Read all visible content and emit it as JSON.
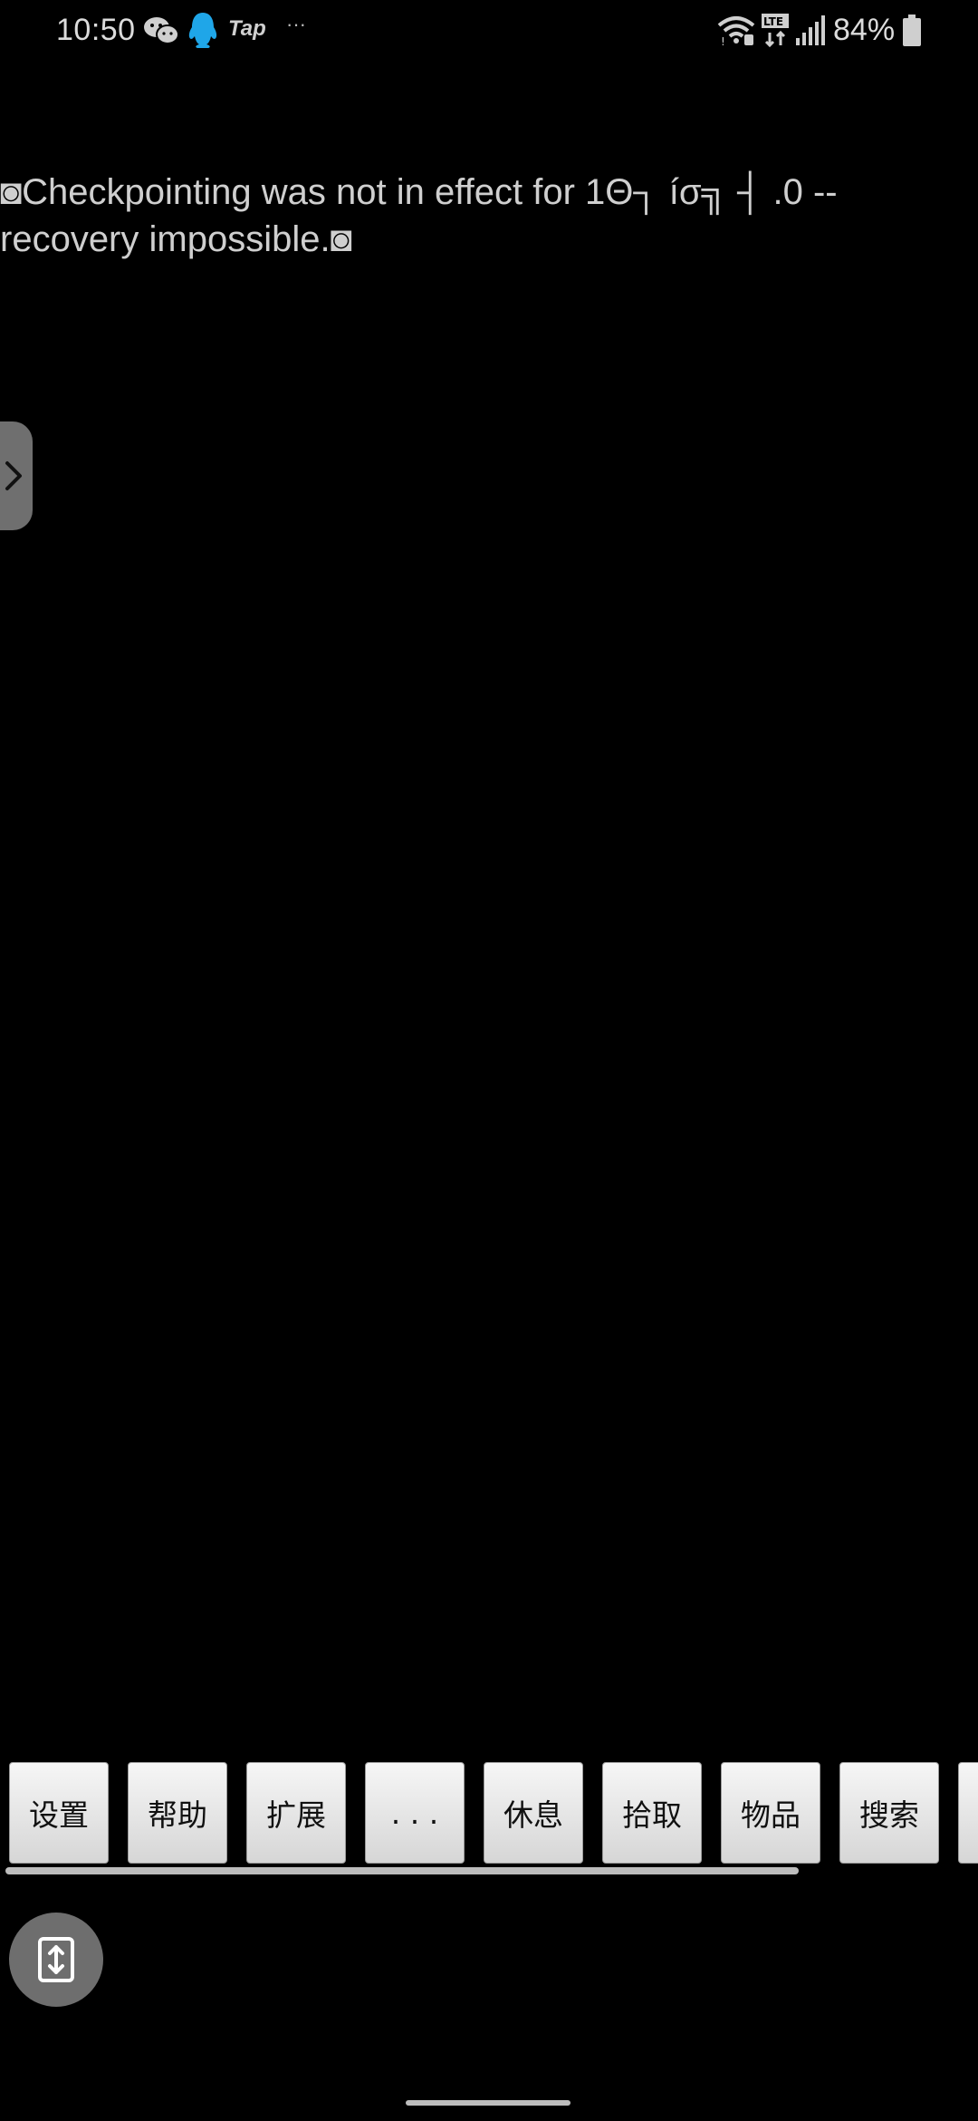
{
  "status_bar": {
    "time": "10:50",
    "tap_label": "Tap",
    "more_label": "···",
    "battery": "84%"
  },
  "terminal": {
    "message": "◙Checkpointing was not in effect for 1Θ┐ íσ╗ ┤ .0 -- recovery impossible.◙"
  },
  "command_bar": {
    "buttons": [
      "设置",
      "帮助",
      "扩展",
      ". . .",
      "休息",
      "拾取",
      "物品",
      "搜索"
    ]
  },
  "icons": {
    "status": [
      "wechat-icon",
      "qq-icon",
      "wifi-icon",
      "lte-icon",
      "signal-icon",
      "battery-icon"
    ],
    "drawer": "chevron-right-icon",
    "fab": "expand-vertical-icon"
  }
}
